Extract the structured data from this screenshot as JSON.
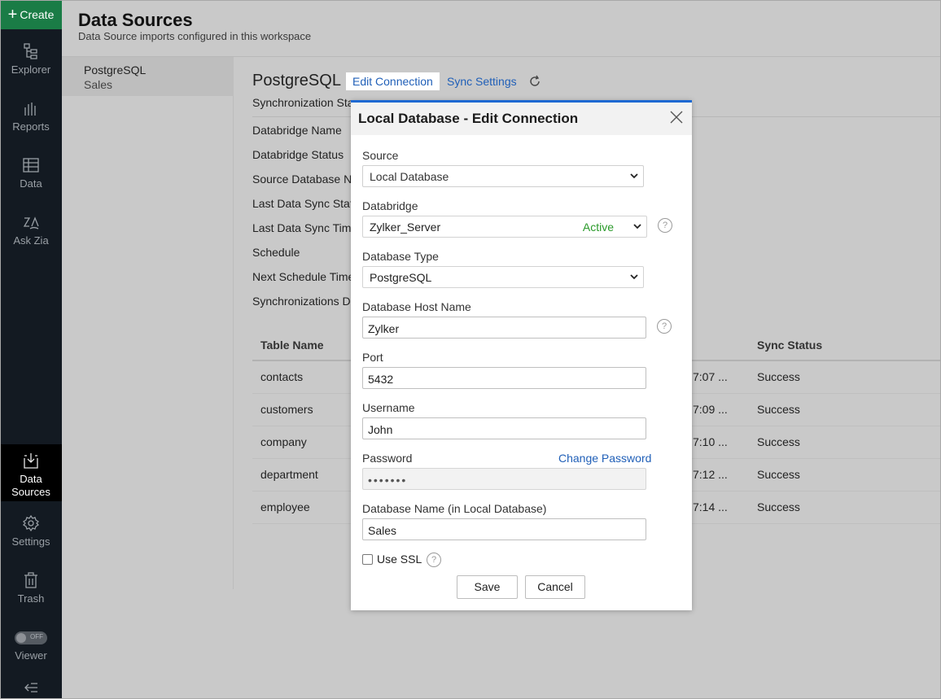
{
  "nav": {
    "create_label": "Create",
    "items": [
      {
        "label": "Explorer",
        "icon": "explorer-icon"
      },
      {
        "label": "Reports",
        "icon": "reports-icon"
      },
      {
        "label": "Data",
        "icon": "data-icon"
      },
      {
        "label": "Ask Zia",
        "icon": "ask-zia-icon"
      },
      {
        "label_line1": "Data",
        "label_line2": "Sources",
        "icon": "data-sources-icon"
      },
      {
        "label": "Settings",
        "icon": "settings-icon"
      },
      {
        "label": "Trash",
        "icon": "trash-icon"
      },
      {
        "label": "Viewer",
        "toggle_text": "OFF"
      }
    ],
    "collapse_icon": "collapse-icon",
    "accent_color": "#1a7c46"
  },
  "header": {
    "title": "Data Sources",
    "subtitle": "Data Source imports configured in this workspace"
  },
  "source_list": {
    "items": [
      {
        "name": "PostgreSQL",
        "sub": "Sales"
      }
    ]
  },
  "detail": {
    "title": "PostgreSQL",
    "tabs": [
      "Edit Connection",
      "Sync Settings"
    ],
    "properties": [
      "Synchronization Sta",
      "Databridge Name",
      "Databridge Status",
      "Source Database Na",
      "Last Data Sync Statu",
      "Last Data Sync Time",
      "Schedule",
      "Next Schedule Time",
      "Synchronizations De"
    ],
    "table": {
      "headers": [
        "Table Name",
        "Sync Status"
      ],
      "rows": [
        {
          "name": "contacts",
          "time": "7:07 ...",
          "status": "Success"
        },
        {
          "name": "customers",
          "time": "7:09 ...",
          "status": "Success"
        },
        {
          "name": "company",
          "time": "7:10 ...",
          "status": "Success"
        },
        {
          "name": "department",
          "time": "7:12 ...",
          "status": "Success"
        },
        {
          "name": "employee",
          "time": "7:14 ...",
          "status": "Success"
        }
      ]
    }
  },
  "modal": {
    "title": "Local Database - Edit Connection",
    "source_label": "Source",
    "source_value": "Local Database",
    "databridge_label": "Databridge",
    "databridge_value": "Zylker_Server",
    "databridge_status": "Active",
    "db_type_label": "Database Type",
    "db_type_value": "PostgreSQL",
    "host_label": "Database Host Name",
    "host_value": "Zylker",
    "port_label": "Port",
    "port_value": "5432",
    "username_label": "Username",
    "username_value": "John",
    "password_label": "Password",
    "change_password": "Change Password",
    "password_value": "•••••••",
    "dbname_label": "Database Name (in Local Database)",
    "dbname_value": "Sales",
    "ssl_label": "Use SSL",
    "help_glyph": "?",
    "save_label": "Save",
    "cancel_label": "Cancel",
    "accent_color": "#1e69d2",
    "status_color": "#2a9a2a"
  }
}
